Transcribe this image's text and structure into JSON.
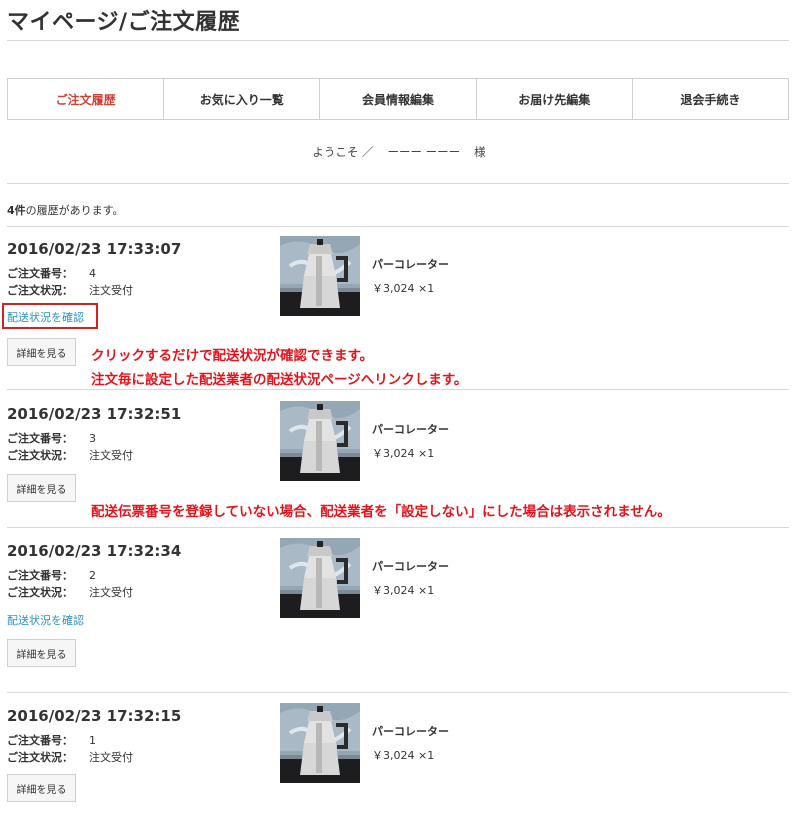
{
  "page": {
    "title": "マイページ/ご注文履歴"
  },
  "tabs": [
    {
      "label": "ご注文履歴",
      "active": true
    },
    {
      "label": "お気に入り一覧"
    },
    {
      "label": "会員情報編集"
    },
    {
      "label": "お届け先編集"
    },
    {
      "label": "退会手続き"
    }
  ],
  "welcome": {
    "prefix": "ようこそ ／",
    "name": "ーーー ーーー",
    "suffix": "様"
  },
  "history_count": {
    "count": "4件",
    "text": "の履歴があります。"
  },
  "labels": {
    "order_no": "ご注文番号：",
    "order_status": "ご注文状況：",
    "track": "配送状況を確認",
    "detail": "詳細を見る"
  },
  "orders": [
    {
      "datetime": "2016/02/23 17:33:07",
      "order_no": "4",
      "status": "注文受付",
      "product": "パーコレーター",
      "price": "￥3,024 ×1",
      "has_track": true
    },
    {
      "datetime": "2016/02/23 17:32:51",
      "order_no": "3",
      "status": "注文受付",
      "product": "パーコレーター",
      "price": "￥3,024 ×1",
      "has_track": false
    },
    {
      "datetime": "2016/02/23 17:32:34",
      "order_no": "2",
      "status": "注文受付",
      "product": "パーコレーター",
      "price": "￥3,024 ×1",
      "has_track": true
    },
    {
      "datetime": "2016/02/23 17:32:15",
      "order_no": "1",
      "status": "注文受付",
      "product": "パーコレーター",
      "price": "￥3,024 ×1",
      "has_track": false
    }
  ],
  "annotations": {
    "note1": "クリックするだけで配送状況が確認できます。",
    "note2": "注文毎に設定した配送業者の配送状況ページへリンクします。",
    "note3": "配送伝票番号を登録していない場合、配送業者を「設定しない」にした場合は表示されません。",
    "color": "#e8121a"
  },
  "colors": {
    "accent": "#d0413a",
    "link": "#2a8fc1"
  },
  "icons": {
    "product_image": "coffee-percolator-photo"
  }
}
